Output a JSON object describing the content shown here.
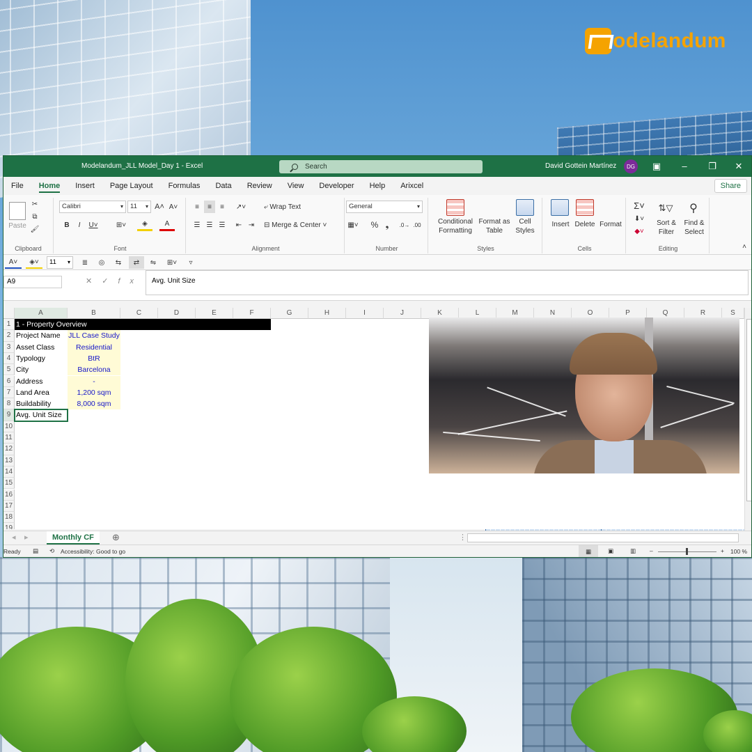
{
  "brand": {
    "name": "odelandum"
  },
  "window": {
    "title": "Modelandum_JLL Model_Day 1  -  Excel",
    "search_placeholder": "Search",
    "user_name": "David Gottein Martínez",
    "user_initials": "DG"
  },
  "menu_tabs": [
    "File",
    "Home",
    "Insert",
    "Page Layout",
    "Formulas",
    "Data",
    "Review",
    "View",
    "Developer",
    "Help",
    "Arixcel"
  ],
  "share_label": "Share",
  "ribbon": {
    "clipboard": {
      "label": "Clipboard",
      "paste": "Paste"
    },
    "font": {
      "label": "Font",
      "name": "Calibri",
      "size": "11"
    },
    "alignment": {
      "label": "Alignment",
      "wrap": "Wrap Text",
      "merge": "Merge & Center"
    },
    "number": {
      "label": "Number",
      "format": "General"
    },
    "styles": {
      "label": "Styles",
      "conditional": "Conditional\nFormatting",
      "format_table": "Format as\nTable",
      "cell_styles": "Cell\nStyles"
    },
    "cells": {
      "label": "Cells",
      "insert": "Insert",
      "delete": "Delete",
      "format": "Format"
    },
    "editing": {
      "label": "Editing",
      "sort": "Sort &\nFilter",
      "find": "Find &\nSelect"
    }
  },
  "quick_bar": {
    "font_size": "11"
  },
  "formula_bar": {
    "name_box": "A9",
    "fx": "fx",
    "content": "Avg. Unit Size"
  },
  "columns": [
    "A",
    "B",
    "C",
    "D",
    "E",
    "F",
    "G",
    "H",
    "I",
    "J",
    "K",
    "L",
    "M",
    "N",
    "O",
    "P",
    "Q",
    "R",
    "S"
  ],
  "rows": [
    "1",
    "2",
    "3",
    "4",
    "5",
    "6",
    "7",
    "8",
    "9",
    "10",
    "11",
    "12",
    "13",
    "14",
    "15",
    "16",
    "17",
    "18",
    "19"
  ],
  "sheet": {
    "section_title": "1 - Property Overview",
    "items": [
      {
        "label": "Project Name",
        "value": "JLL Case Study"
      },
      {
        "label": "Asset Class",
        "value": "Residential"
      },
      {
        "label": "Typology",
        "value": "BtR"
      },
      {
        "label": "City",
        "value": "Barcelona"
      },
      {
        "label": "Address",
        "value": "-"
      },
      {
        "label": "Land Area",
        "value": "1,200 sqm"
      },
      {
        "label": "Buildability",
        "value": "8,000 sqm"
      },
      {
        "label": "Avg. Unit Size",
        "value": ""
      }
    ]
  },
  "sheet_tab": "Monthly CF",
  "status": {
    "ready": "Ready",
    "accessibility": "Accessibility: Good to go",
    "zoom": "100 %"
  },
  "colors": {
    "excel_green": "#1e7145",
    "input_fill": "#fffbd6",
    "input_text": "#1515c8",
    "brand_orange": "#f5a300"
  }
}
